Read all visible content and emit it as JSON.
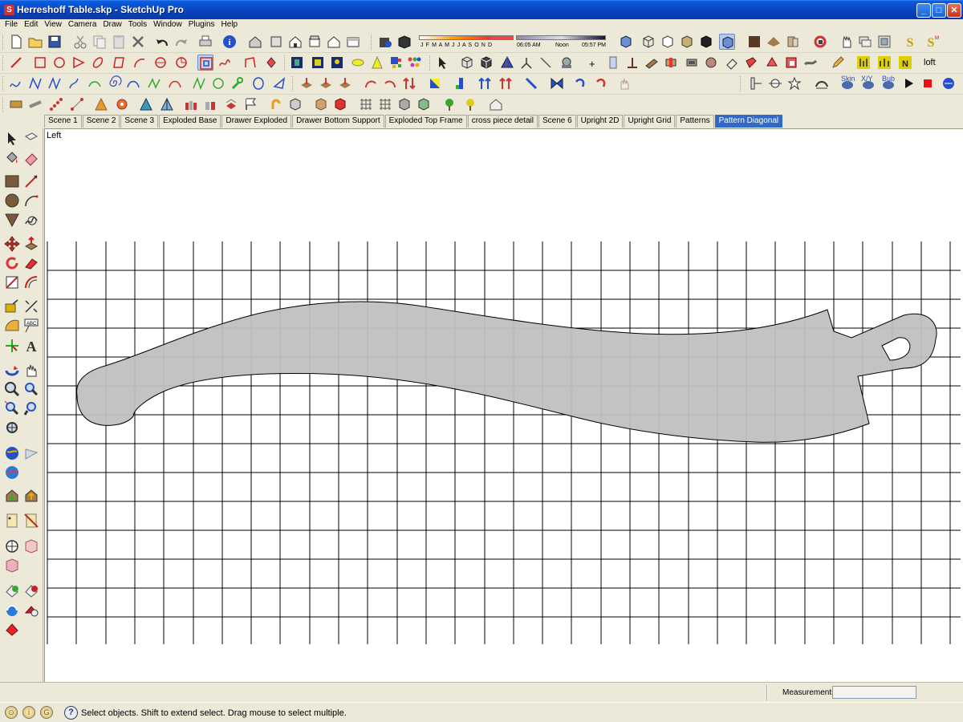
{
  "window": {
    "title": "Herreshoff Table.skp - SketchUp Pro",
    "minimize": "_",
    "maximize": "□",
    "close": "✕"
  },
  "menu": [
    "File",
    "Edit",
    "View",
    "Camera",
    "Draw",
    "Tools",
    "Window",
    "Plugins",
    "Help"
  ],
  "shadow_settings": {
    "months": "J F M A M J J A S O N D",
    "time_start": "06:05 AM",
    "noon": "Noon",
    "time_end": "05:57 PM"
  },
  "toolbar_text": {
    "loft": "loft",
    "skin": "Skin",
    "xyz": "X/Y",
    "bub": "Bub",
    "abc": "ABC"
  },
  "scenes": [
    {
      "label": "Scene 1",
      "active": false
    },
    {
      "label": "Scene 2",
      "active": false
    },
    {
      "label": "Scene 3",
      "active": false
    },
    {
      "label": "Exploded Base",
      "active": false
    },
    {
      "label": "Drawer Exploded",
      "active": false
    },
    {
      "label": "Drawer Bottom Support",
      "active": false
    },
    {
      "label": "Exploded Top Frame",
      "active": false
    },
    {
      "label": "cross piece detail",
      "active": false
    },
    {
      "label": "Scene 6",
      "active": false
    },
    {
      "label": "Upright 2D",
      "active": false
    },
    {
      "label": "Upright Grid",
      "active": false
    },
    {
      "label": "Patterns",
      "active": false
    },
    {
      "label": "Pattern Diagonal",
      "active": true
    }
  ],
  "viewport": {
    "view_name": "Left",
    "shape_fill": "#c0c0c0",
    "grid_color": "#000000"
  },
  "measurements": {
    "label": "Measurements",
    "value": ""
  },
  "status": {
    "text": "Select objects. Shift to extend select. Drag mouse to select multiple.",
    "help": "?"
  },
  "colors": {
    "titlebar": "#0a49c5",
    "active_tab": "#316ac5",
    "chrome": "#ece9d8"
  }
}
